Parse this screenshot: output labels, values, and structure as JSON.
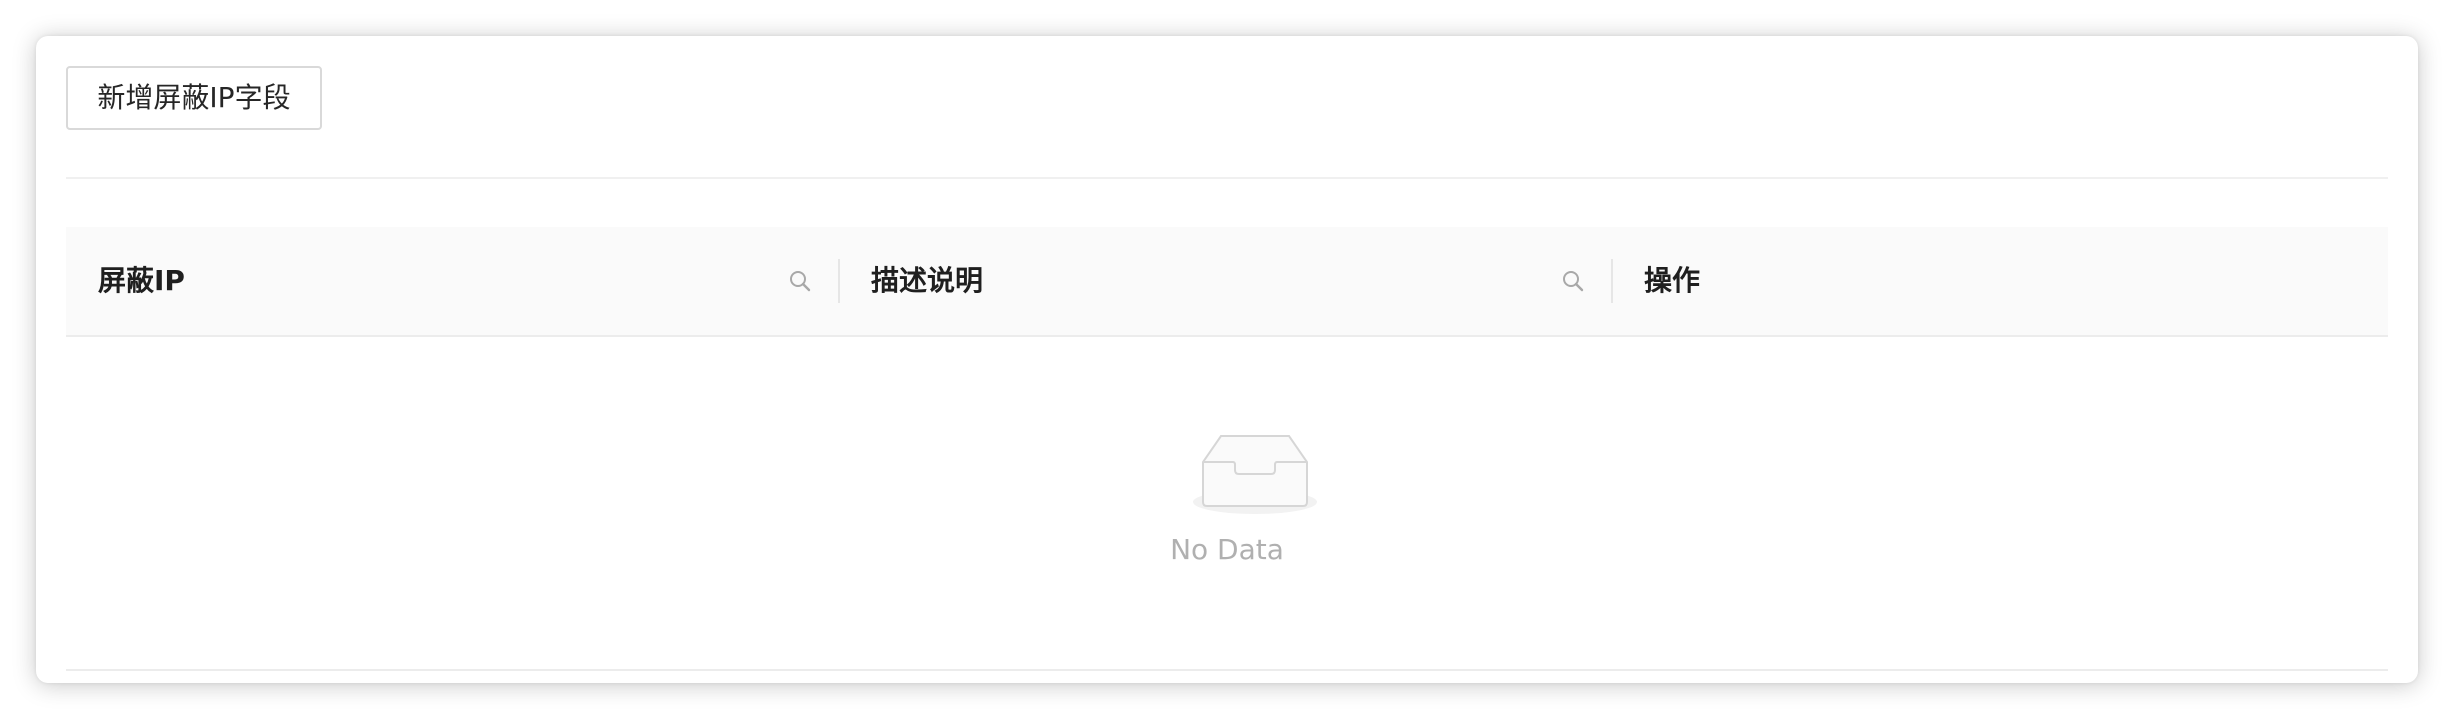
{
  "toolbar": {
    "add_button_label": "新增屏蔽IP字段"
  },
  "table": {
    "columns": [
      {
        "label": "屏蔽IP",
        "icon": "search-icon"
      },
      {
        "label": "描述说明",
        "icon": "search-icon"
      },
      {
        "label": "操作"
      }
    ],
    "rows": [],
    "empty": {
      "icon": "empty-inbox-icon",
      "text": "No Data"
    }
  },
  "colors": {
    "header_bg": "#fafafa",
    "border": "#d9d9d9",
    "empty_text": "#b0b0b0"
  }
}
